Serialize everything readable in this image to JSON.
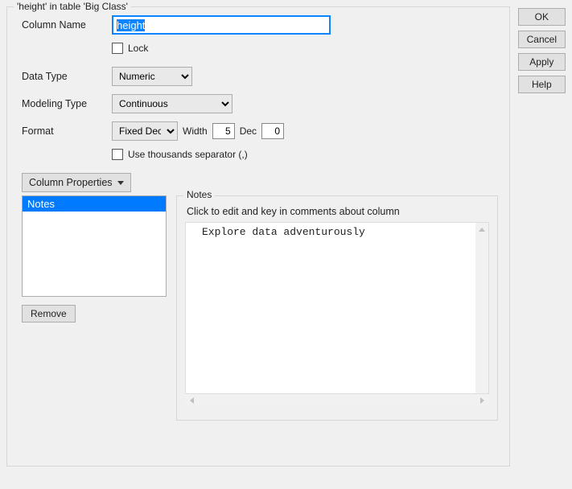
{
  "fieldset_title": "'height' in table 'Big Class'",
  "labels": {
    "column_name": "Column Name",
    "data_type": "Data Type",
    "modeling_type": "Modeling Type",
    "format": "Format",
    "lock": "Lock",
    "width": "Width",
    "dec": "Dec",
    "use_thousands": "Use thousands separator (,)",
    "column_properties": "Column Properties",
    "remove": "Remove"
  },
  "values": {
    "column_name": "height",
    "data_type": "Numeric",
    "modeling_type": "Continuous",
    "format_type": "Fixed Dec",
    "width": "5",
    "dec": "0",
    "lock_checked": false,
    "use_thousands_checked": false
  },
  "properties_list": [
    "Notes"
  ],
  "notes_panel": {
    "title": "Notes",
    "hint": "Click to edit and key in comments about column",
    "content": "Explore data adventurously"
  },
  "actions": {
    "ok": "OK",
    "cancel": "Cancel",
    "apply": "Apply",
    "help": "Help"
  }
}
